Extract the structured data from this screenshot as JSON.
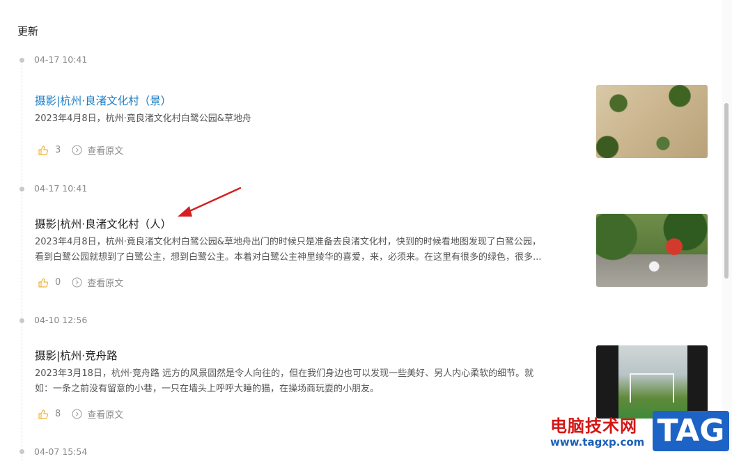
{
  "section": {
    "title": "更新"
  },
  "entries": [
    {
      "timestamp": "04-17 10:41",
      "title": "摄影|杭州·良渚文化村（景）",
      "excerpt": [
        "2023年4月8日，杭州·竟良渚文化村白鹭公园&草地舟"
      ],
      "likes": "3",
      "view_label": "查看原文"
    },
    {
      "timestamp": "04-17 10:41",
      "title": "摄影|杭州·良渚文化村（人）",
      "excerpt": [
        "2023年4月8日，杭州·竟良渚文化村白鹭公园&草地舟出门的时候只是准备去良渚文化村，快到的时候看地图发现了白鹭公园，",
        "看到白鹭公园就想到了白鹭公主，想到白鹭公主。本着对白鹭公主神里绫华的喜爱，来，必须来。在这里有很多的绿色，很多..."
      ],
      "likes": "0",
      "view_label": "查看原文"
    },
    {
      "timestamp": "04-10 12:56",
      "title": "摄影|杭州·竞舟路",
      "excerpt": [
        "2023年3月18日，杭州·竞舟路 远方的风景固然是令人向往的，但在我们身边也可以发现一些美好、另人内心柔软的细节。就",
        "如：一条之前没有留意的小巷，一只在墙头上呼呼大睡的猫，在操场商玩耍的小朋友。"
      ],
      "likes": "8",
      "view_label": "查看原文"
    },
    {
      "timestamp": "04-07 15:54"
    }
  ],
  "watermark": {
    "site_name": "电脑技术网",
    "url": "www.tagxp.com",
    "tag": "TAG"
  },
  "colors": {
    "link": "#1f7ec4",
    "arrow": "#d42020",
    "like_icon": "#f0b23a"
  }
}
